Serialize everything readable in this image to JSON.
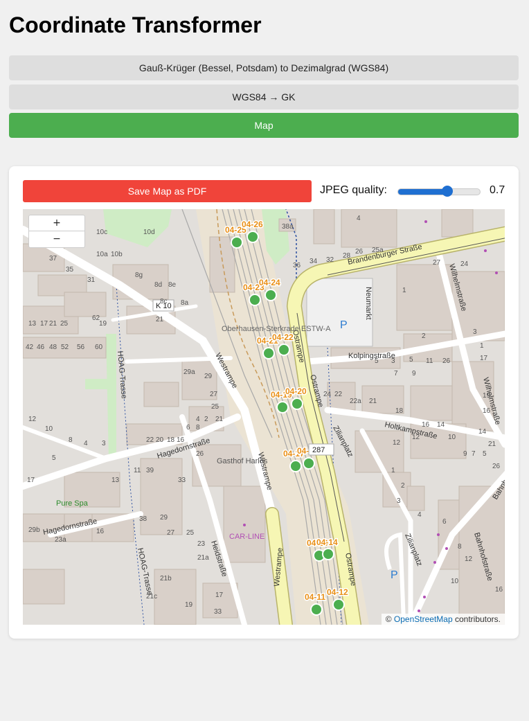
{
  "page": {
    "title": "Coordinate Transformer"
  },
  "nav": {
    "btn1": "Gauß-Krüger (Bessel, Potsdam) to Dezimalgrad (WGS84)",
    "btn2": "WGS84 → GK",
    "btn3": "Map",
    "active_color": "#4cae4f"
  },
  "toolbar": {
    "save_label": "Save Map as PDF",
    "save_color": "#f0443a",
    "quality_label": "JPEG quality:",
    "quality_value": "0.7",
    "quality_fraction": 0.6
  },
  "map": {
    "zoom_in": "+",
    "zoom_out": "−",
    "attribution_prefix": "©",
    "attribution_link": "OpenStreetMap",
    "attribution_suffix": "contributors.",
    "markers": [
      "04-25",
      "04-26",
      "04-23",
      "04-24",
      "04-21",
      "04-22",
      "04-19",
      "04-20",
      "04-17",
      "04-18",
      "04-13",
      "04-14",
      "04-11",
      "04-12"
    ],
    "streets": [
      "Brandenburger Straße",
      "Neumarkt",
      "Kolpingstraße",
      "Holtkampstraße",
      "Wilhelmstraße",
      "Ostrampe",
      "Westrampe",
      "Zilianplatz",
      "Hagedornstraße",
      "Heidstraße",
      "HOAG-Trasse",
      "Bahnhofstraße",
      "K 10",
      "287"
    ],
    "pois": [
      "Oberhausen-Sterkrade ESTW-A",
      "Gasthof Harlos",
      "Pure Spa",
      "CAR-LINE",
      "P"
    ],
    "house_numbers": [
      "38a",
      "10c",
      "10d",
      "10a",
      "10b",
      "37",
      "35",
      "31",
      "8g",
      "8d",
      "8e",
      "8c",
      "8a",
      "62",
      "21",
      "13",
      "17",
      "21",
      "25",
      "19",
      "42",
      "46",
      "48",
      "52",
      "56",
      "60",
      "29a",
      "29",
      "27",
      "25",
      "21",
      "8",
      "6",
      "4",
      "2",
      "22",
      "20",
      "18",
      "16",
      "12",
      "10",
      "8",
      "4",
      "3",
      "5",
      "26",
      "17",
      "13",
      "11",
      "39",
      "33",
      "29",
      "27",
      "25",
      "23",
      "21a",
      "21b",
      "21c",
      "19",
      "17",
      "33",
      "29b",
      "23a",
      "16",
      "38",
      "36",
      "34",
      "32",
      "28",
      "26",
      "25a",
      "27",
      "24",
      "4",
      "1",
      "2",
      "5",
      "3",
      "5",
      "7",
      "9",
      "11",
      "26",
      "24",
      "22",
      "22a",
      "21",
      "18",
      "16",
      "14",
      "12",
      "10",
      "9",
      "7",
      "5",
      "3",
      "1",
      "17",
      "21",
      "19",
      "16",
      "14",
      "12",
      "1",
      "2",
      "3",
      "4",
      "6",
      "8",
      "10",
      "12",
      "16",
      "26",
      "26b",
      "35",
      "31"
    ]
  }
}
